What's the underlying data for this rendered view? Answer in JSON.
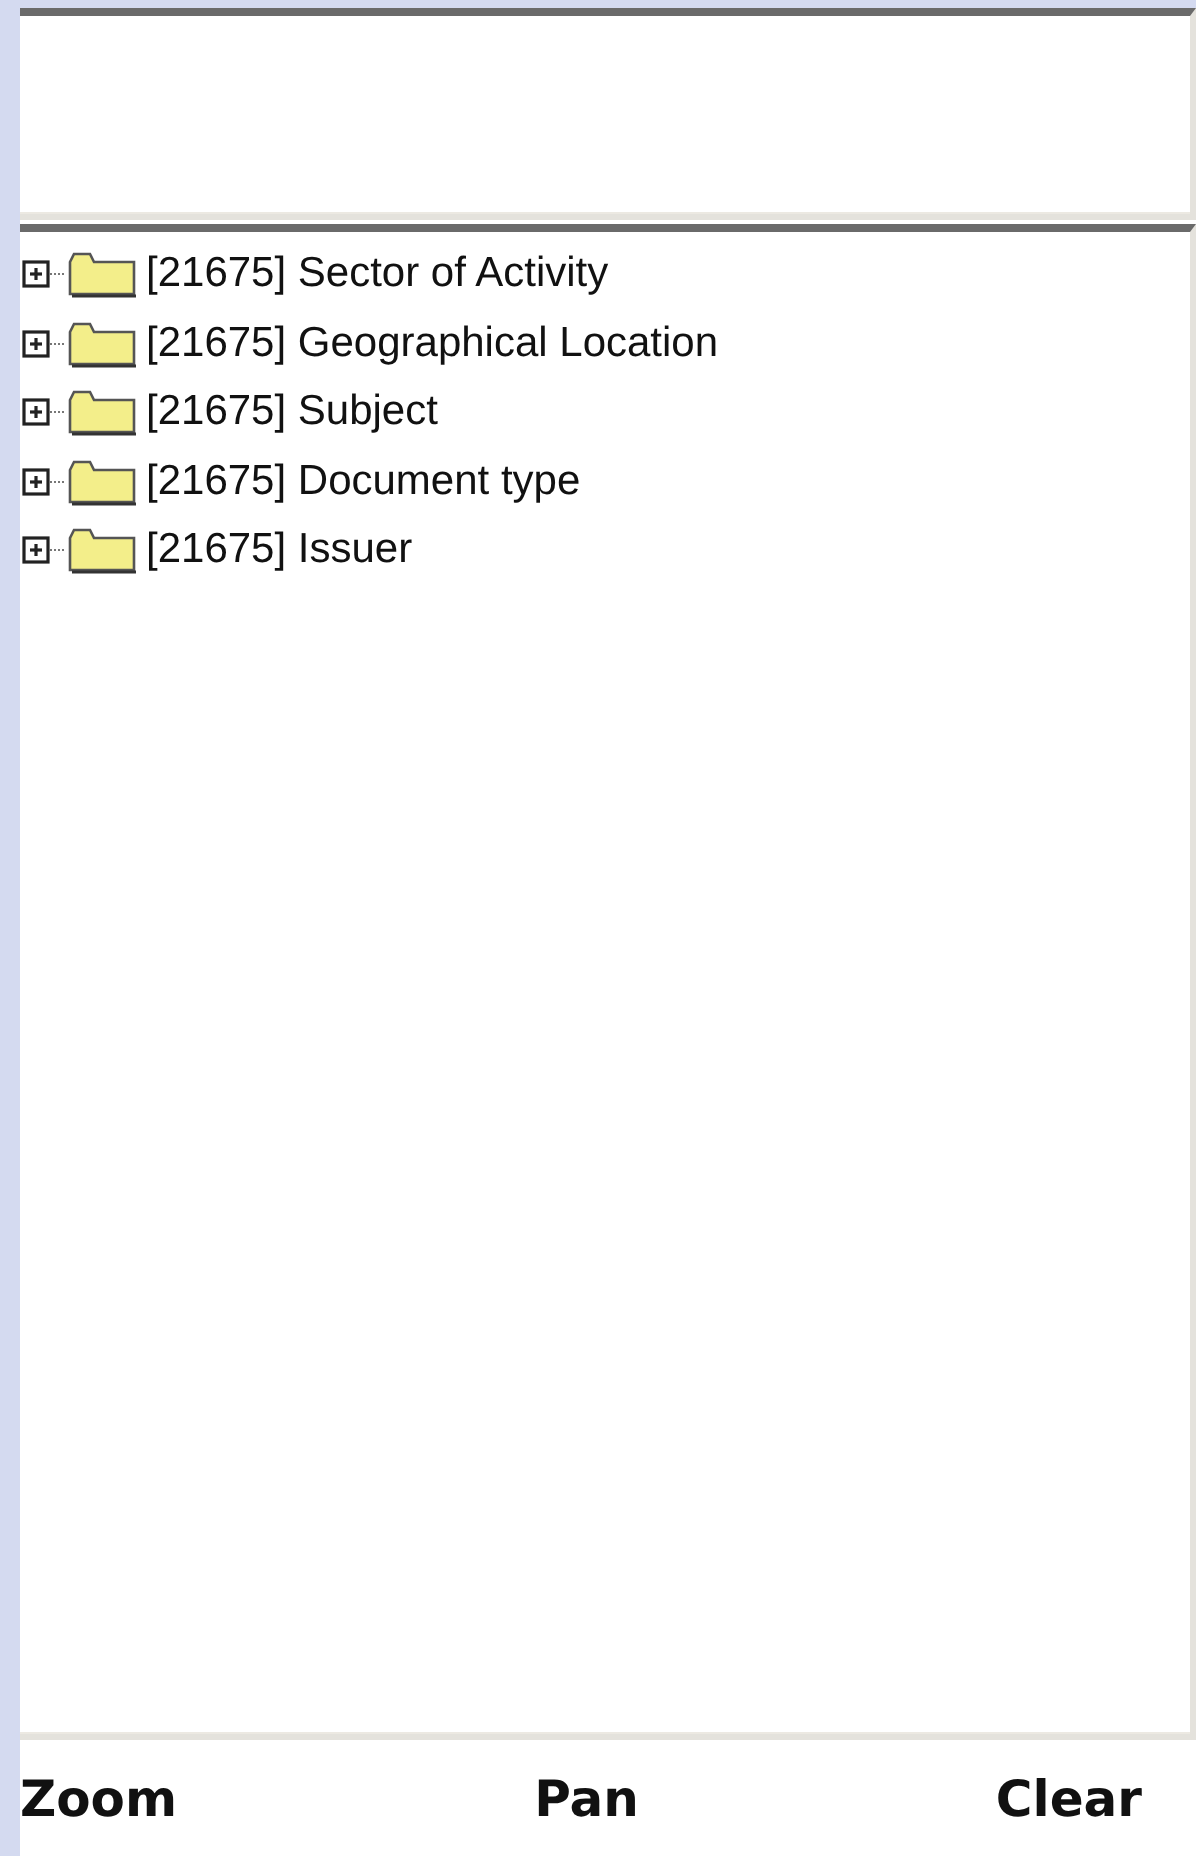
{
  "tree": {
    "items": [
      {
        "label": "[21675] Sector of Activity",
        "expanded": false
      },
      {
        "label": "[21675] Geographical Location",
        "expanded": false
      },
      {
        "label": "[21675] Subject",
        "expanded": false
      },
      {
        "label": "[21675] Document type",
        "expanded": false
      },
      {
        "label": "[21675] Issuer",
        "expanded": false
      }
    ]
  },
  "toolbar": {
    "buttons": [
      "Zoom",
      "Pan",
      "Clear"
    ]
  }
}
